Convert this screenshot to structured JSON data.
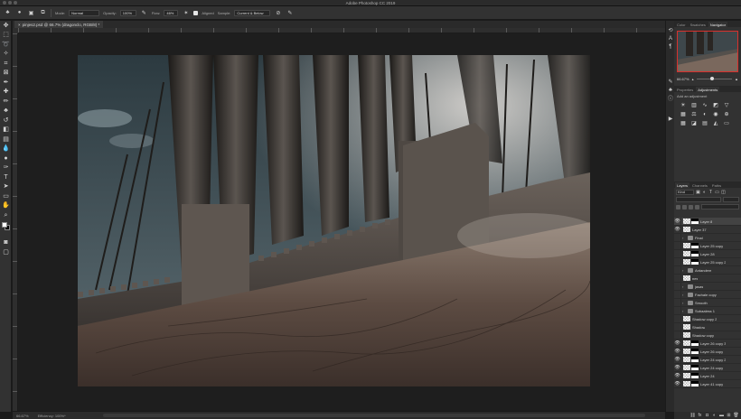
{
  "app": {
    "title": "Adobe Photoshop CC 2019"
  },
  "options_bar": {
    "mode_label": "Mode:",
    "mode_value": "Normal",
    "opacity_label": "Opacity:",
    "opacity_value": "100%",
    "flow_label": "Flow:",
    "flow_value": "46%",
    "aligned_label": "Aligned",
    "sample_label": "Sample:",
    "sample_value": "Current & Below"
  },
  "document": {
    "tab_label": "pinjes2.psd @ 66.7% (dragonclo, RGB/8) *"
  },
  "status": {
    "zoom": "66.67%",
    "efficiency": "Efficiency: 100%*"
  },
  "navigator": {
    "tabs": [
      "Color",
      "Swatches",
      "Navigator"
    ],
    "zoom": "66.67%"
  },
  "adjustments": {
    "tabs": [
      "Properties",
      "Adjustments"
    ],
    "hint": "Add an adjustment"
  },
  "layers": {
    "tabs": [
      "Layers",
      "Channels",
      "Paths"
    ],
    "filter": "Kind",
    "items": [
      {
        "name": "Layer 8",
        "visible": true,
        "kind": "mask"
      },
      {
        "name": "Layer 37",
        "visible": true,
        "kind": "layer"
      },
      {
        "name": "Final",
        "visible": false,
        "kind": "group"
      },
      {
        "name": "Layer 25 copy",
        "visible": false,
        "kind": "mask"
      },
      {
        "name": "Layer 28",
        "visible": false,
        "kind": "mask"
      },
      {
        "name": "Layer 25 copy 2",
        "visible": false,
        "kind": "mask"
      },
      {
        "name": "Antandere",
        "visible": false,
        "kind": "group"
      },
      {
        "name": "nes",
        "visible": false,
        "kind": "layer"
      },
      {
        "name": "jasas",
        "visible": false,
        "kind": "group"
      },
      {
        "name": "Fachale copy",
        "visible": false,
        "kind": "group"
      },
      {
        "name": "Smooth",
        "visible": false,
        "kind": "group"
      },
      {
        "name": "Subaaless 1",
        "visible": false,
        "kind": "group"
      },
      {
        "name": "Shadow copy 2",
        "visible": false,
        "kind": "layer"
      },
      {
        "name": "Shadow",
        "visible": false,
        "kind": "layer"
      },
      {
        "name": "Shadow copy",
        "visible": false,
        "kind": "layer"
      },
      {
        "name": "Layer 26 copy 3",
        "visible": true,
        "kind": "mask"
      },
      {
        "name": "Layer 26 copy",
        "visible": true,
        "kind": "mask"
      },
      {
        "name": "Layer 24 copy 2",
        "visible": true,
        "kind": "mask"
      },
      {
        "name": "Layer 24 copy",
        "visible": true,
        "kind": "mask"
      },
      {
        "name": "Layer 24",
        "visible": true,
        "kind": "mask"
      },
      {
        "name": "Layer 41 copy",
        "visible": true,
        "kind": "mask"
      }
    ]
  }
}
